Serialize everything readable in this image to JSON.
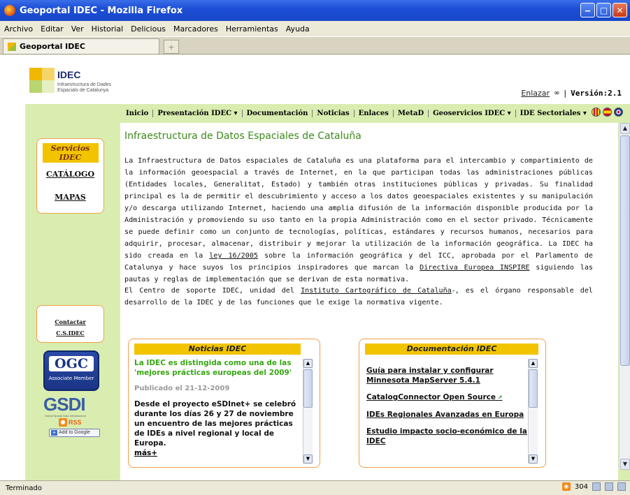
{
  "window": {
    "title": "Geoportal IDEC - Mozilla Firefox",
    "min_icon": "minimize-icon",
    "max_icon": "maximize-icon",
    "close_icon": "close-icon"
  },
  "menu": [
    "Archivo",
    "Editar",
    "Ver",
    "Historial",
    "Delicious",
    "Marcadores",
    "Herramientas",
    "Ayuda"
  ],
  "tabs": [
    {
      "label": "Geoportal IDEC"
    }
  ],
  "newtab_symbol": "+",
  "header": {
    "logo_name": "IDEC",
    "logo_sub1": "Infraestructura de Dades",
    "logo_sub2": "Espacials de Catalunya",
    "enlazar": "Enlazar",
    "separator": "|",
    "version": "Versión:2.1"
  },
  "nav": [
    "Inicio",
    "Presentación IDEC ▾",
    "Documentación",
    "Noticias",
    "Enlaces",
    "MetaD",
    "Geoservicios IDEC ▾",
    "IDE Sectoriales ▾"
  ],
  "sidebar": {
    "servicios": "Servicios IDEC",
    "catalogo": "CATÁLOGO",
    "mapas": "MAPAS",
    "contactar": "Contactar",
    "csidec": "C.S.IDEC",
    "ogc_big": "OGC",
    "ogc_small": "Associate Member",
    "gsdi": "GSDI",
    "gsdi_small": "Global Spatial Data Infrastructure",
    "rss": "RSS",
    "add_google": "Add to Google"
  },
  "main": {
    "title": "Infraestructura de Datos Espaciales de Cataluña",
    "p1_a": "La Infraestructura de Datos espaciales de Cataluña es una plataforma para el intercambio y compartimiento de la información geoespacial a través de Internet, en la que participan todas las administraciones públicas (Entidades locales, Generalitat, Estado) y también otras instituciones públicas y privadas. Su finalidad principal es la de permitir el descubrimiento y acceso a los datos geoespaciales existentes y su manipulación y/o descarga utilizando Internet, haciendo una amplia difusión de la información disponible producida por la Administración y promoviendo su uso tanto en la propia Administración como en el sector privado. Técnicamente se puede definir como un conjunto de tecnologías, políticas, estándares y recursos humanos, necesarios para adquirir, procesar, almacenar, distribuir y mejorar la utilización de la información geográfica. La IDEC ha sido creada en la ",
    "p1_link1": "ley 16/2005",
    "p1_b": " sobre la información geográfica y del ICC, aprobada por el Parlamento de Catalunya y hace suyos los principios inspiradores que marcan la ",
    "p1_link2": "Directiva Europea INSPIRE",
    "p1_c": " siguiendo las pautas y reglas de implementación que se derivan de esta normativa.",
    "p2_a": "El Centro de soporte IDEC, unidad del ",
    "p2_link": "Instituto Cartográfico de Cataluña",
    "p2_b": ", es el órgano responsable del desarrollo de la IDEC y de las funciones que le exige la normativa vigente."
  },
  "news": {
    "header": "Noticias IDEC",
    "title": "La IDEC es distingida como una de las 'mejores prácticas europeas del 2009'",
    "date": "Publicado el 21-12-2009",
    "body": "Desde el proyecto eSDInet+ se celebró durante los días 26 y 27 de noviembre un encuentro de las mejores prácticas de IDEs a nivel regional y local de Europa.",
    "more": "más+"
  },
  "docs": {
    "header": "Documentación IDEC",
    "items": [
      "Guía para instalar y configurar Minnesota MapServer 5.4.1",
      "CatalogConnector Open Source",
      "IDEs Regionales Avanzadas en Europa",
      "Estudio impacto socio-económico de la IDEC"
    ]
  },
  "status": {
    "text": "Terminado",
    "count": "304"
  },
  "icons": {
    "ext_link": "external-link-icon",
    "glasses": "enlazar-glasses-icon"
  },
  "colors": {
    "green_bg": "#d9edb0",
    "title_green": "#3d8a1a",
    "header_yellow": "#f2c400",
    "box_border": "#f1a04a"
  }
}
